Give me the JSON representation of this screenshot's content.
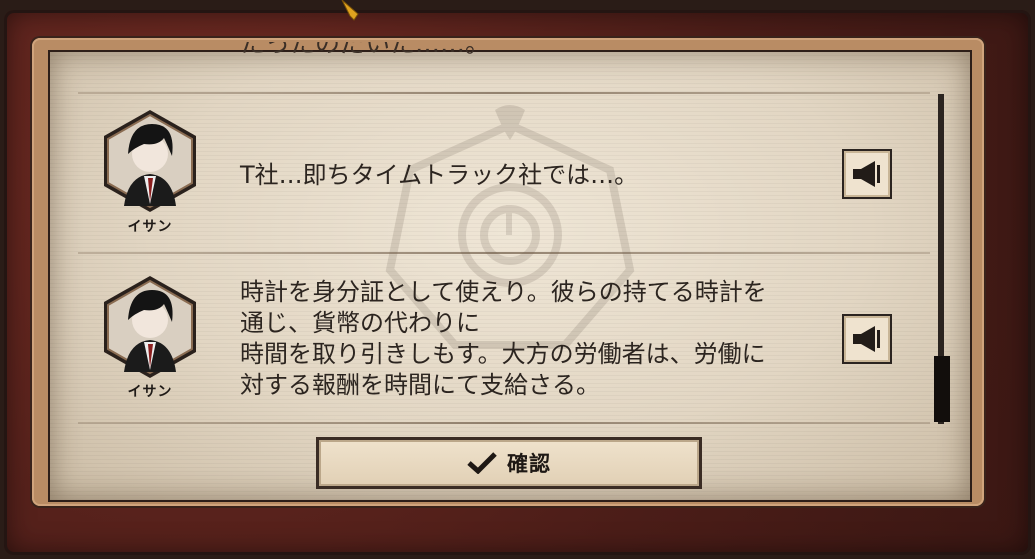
{
  "dialog": {
    "clipped_line": "たったのだいた……。",
    "confirm_label": "確認"
  },
  "messages": [
    {
      "speaker": "イサン",
      "text": "T社…即ちタイムトラック社では…。",
      "voice_icon": "speaker-icon"
    },
    {
      "speaker": "イサン",
      "text": "時計を身分証として使えり。彼らの持てる時計を\n通じ、貨幣の代わりに\n時間を取り引きしもす。大方の労働者は、労働に\n対する報酬を時間にて支給さる。",
      "voice_icon": "speaker-icon"
    }
  ],
  "icons": {
    "confirm": "checkmark-icon",
    "emblem": "clock-emblem-icon"
  },
  "colors": {
    "frame": "#4b1d18",
    "paper": "#e6dccb",
    "ink": "#2c2520"
  }
}
